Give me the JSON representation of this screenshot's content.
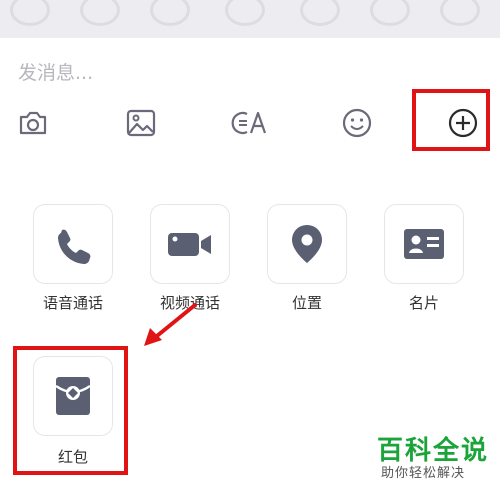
{
  "input": {
    "placeholder": "发消息..."
  },
  "toolbar": {
    "items": [
      {
        "icon": "camera-icon"
      },
      {
        "icon": "image-icon"
      },
      {
        "icon": "voice-to-text-icon"
      },
      {
        "icon": "emoji-icon"
      },
      {
        "icon": "plus-circle-icon",
        "highlighted": true
      }
    ]
  },
  "actions": {
    "items": [
      {
        "label": "语音通话",
        "icon": "phone-icon"
      },
      {
        "label": "视频通话",
        "icon": "video-camera-icon"
      },
      {
        "label": "位置",
        "icon": "location-pin-icon"
      },
      {
        "label": "名片",
        "icon": "contact-card-icon"
      },
      {
        "label": "红包",
        "icon": "red-envelope-icon",
        "highlighted": true
      }
    ]
  },
  "watermark": {
    "title": "百科全说",
    "subtitle": "助你轻松解决"
  },
  "colors": {
    "icon": "#6a6a7a",
    "tile_icon": "#5b5f72",
    "highlight": "#e01414",
    "watermark_green": "#1aa43a",
    "top_strip": "#ececf1"
  }
}
